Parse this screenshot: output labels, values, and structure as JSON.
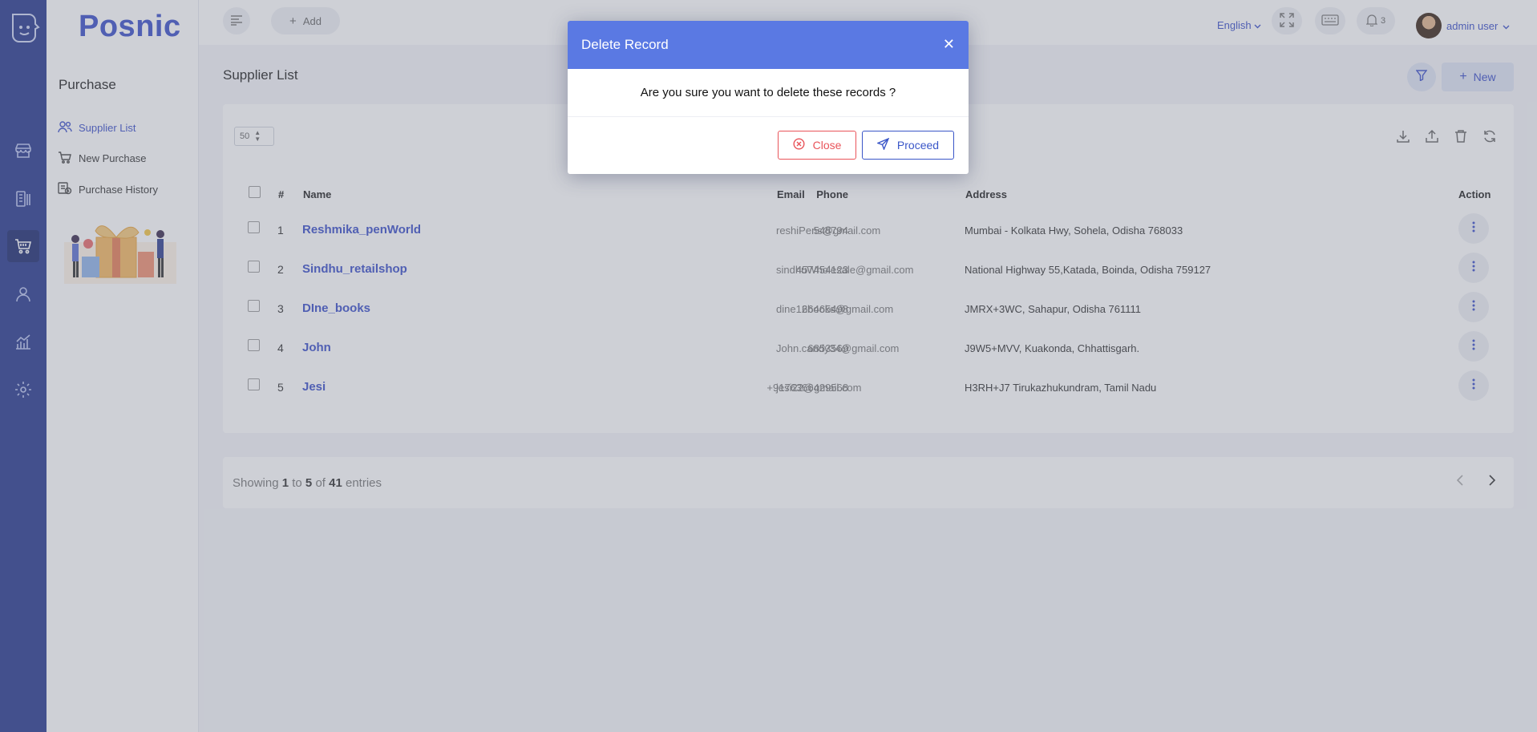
{
  "brand": {
    "name": "Posnic"
  },
  "topbar": {
    "add_label": "Add",
    "language": "English",
    "notifications_count": "3",
    "user_name": "admin user"
  },
  "sidebar": {
    "title": "Purchase",
    "items": [
      {
        "label": "Supplier List",
        "icon": "users-icon"
      },
      {
        "label": "New Purchase",
        "icon": "cart-icon"
      },
      {
        "label": "Purchase History",
        "icon": "history-icon"
      }
    ]
  },
  "page": {
    "title": "Supplier List",
    "new_label": "New",
    "per_page": "50"
  },
  "table": {
    "headers": {
      "num": "#",
      "name": "Name",
      "phone": "Phone",
      "email": "Email",
      "address": "Address",
      "action": "Action"
    },
    "rows": [
      {
        "num": "1",
        "name": "Reshmika_penWorld",
        "phone": "548794",
        "email": "reshiPens@gmail.com",
        "address": "Mumbai - Kolkata Hwy, Sohela, Odisha 768033"
      },
      {
        "num": "2",
        "name": "Sindhu_retailshop",
        "phone": "457454123",
        "email": "sindhuWholesale@gmail.com",
        "address": "National Highway 55,Katada, Boinda, Odisha 759127"
      },
      {
        "num": "3",
        "name": "DIne_books",
        "phone": "66465498",
        "email": "dine12books@gmail.com",
        "address": "JMRX+3WC, Sahapur, Odisha 761111"
      },
      {
        "num": "4",
        "name": "John",
        "phone": "6853569",
        "email": "John.candy34@gmail.com",
        "address": "J9W5+MVV, Kuakonda, Chhattisgarh."
      },
      {
        "num": "5",
        "name": "Jesi",
        "phone": "+9176366429568",
        "email": "jesi22@gmail.com",
        "address": "H3RH+J7 Tirukazhukundram, Tamil Nadu"
      }
    ]
  },
  "footer": {
    "showing_prefix": "Showing",
    "from": "1",
    "to_word": "to",
    "to": "5",
    "of_word": "of",
    "total": "41",
    "entries_word": "entries"
  },
  "modal": {
    "title": "Delete Record",
    "message": "Are you sure you want to delete these records ?",
    "close_label": "Close",
    "proceed_label": "Proceed"
  },
  "colors": {
    "rail": "#27388e",
    "accent": "#3a4fc9",
    "modal_header": "#5a79e3",
    "danger": "#e9545a"
  }
}
